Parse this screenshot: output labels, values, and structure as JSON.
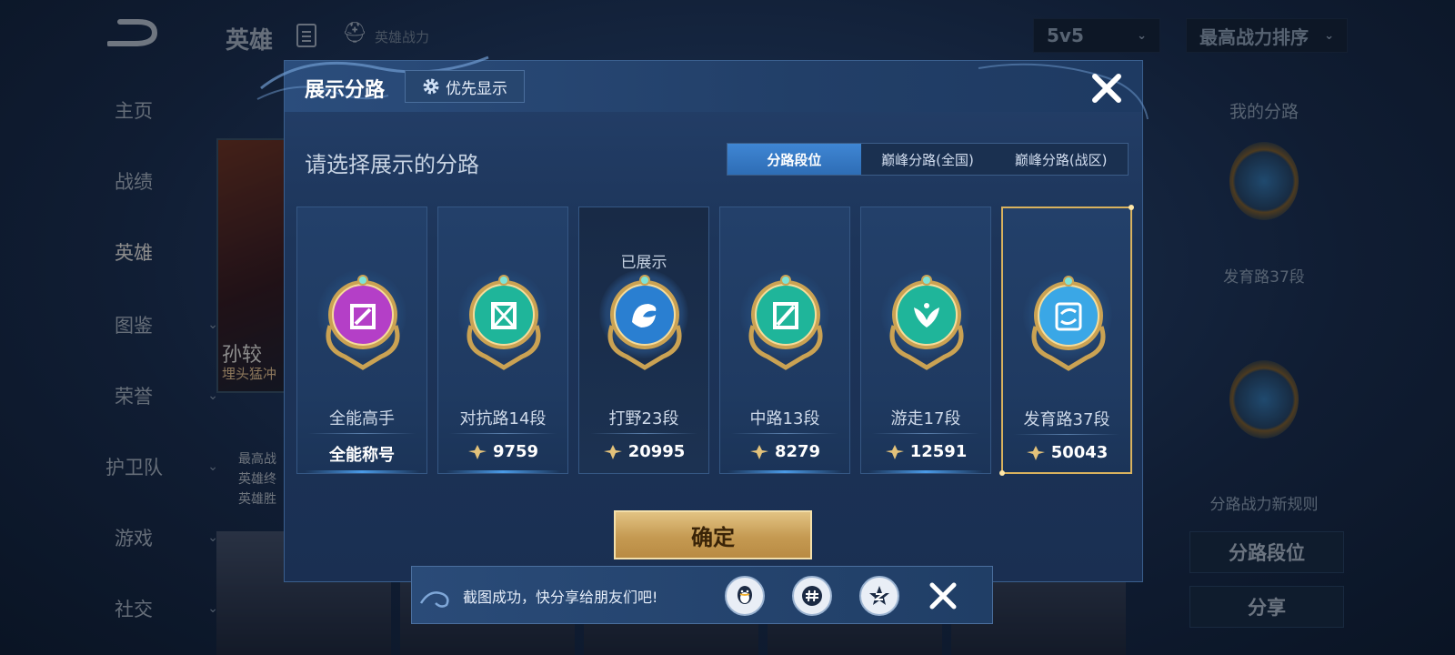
{
  "background": {
    "title": "英雄",
    "subtitle": "英雄战力",
    "mode_select": "5v5",
    "sort_select": "最高战力排序",
    "nav": [
      {
        "label": "主页",
        "chevron": false,
        "active": false
      },
      {
        "label": "战绩",
        "chevron": false,
        "active": false
      },
      {
        "label": "英雄",
        "chevron": false,
        "active": true
      },
      {
        "label": "图鉴",
        "chevron": true,
        "active": false
      },
      {
        "label": "荣誉",
        "chevron": true,
        "active": false
      },
      {
        "label": "护卫队",
        "chevron": true,
        "active": false
      },
      {
        "label": "游戏",
        "chevron": true,
        "active": false
      },
      {
        "label": "社交",
        "chevron": true,
        "active": false
      }
    ],
    "hero_name": "孙较",
    "hero_tag": "埋头猛冲",
    "hero_info": [
      "最高战",
      "英雄终",
      "英雄胜"
    ],
    "right_panel": {
      "title": "我的分路",
      "lane": "发育路37段",
      "rules_link": "分路战力新规则",
      "lane_button": "分路段位",
      "share_button": "分享"
    }
  },
  "dialog": {
    "title": "展示分路",
    "priority_button": "优先显示",
    "subtitle": "请选择展示的分路",
    "tabs": [
      {
        "label": "分路段位",
        "active": true
      },
      {
        "label": "巅峰分路(全国)",
        "active": false
      },
      {
        "label": "巅峰分路(战区)",
        "active": false
      }
    ],
    "cards": [
      {
        "name": "全能高手",
        "value": "全能称号",
        "power_icon": false,
        "shown_label": "",
        "badge": "all-round-badge-icon",
        "color": "#b43fc7",
        "selected": false
      },
      {
        "name": "对抗路14段",
        "value": "9759",
        "power_icon": true,
        "shown_label": "",
        "badge": "clash-lane-badge-icon",
        "color": "#1fb59a",
        "selected": false
      },
      {
        "name": "打野23段",
        "value": "20995",
        "power_icon": true,
        "shown_label": "已展示",
        "badge": "jungle-badge-icon",
        "color": "#2a7fd1",
        "selected": false
      },
      {
        "name": "中路13段",
        "value": "8279",
        "power_icon": true,
        "shown_label": "",
        "badge": "mid-lane-badge-icon",
        "color": "#1fb59a",
        "selected": false
      },
      {
        "name": "游走17段",
        "value": "12591",
        "power_icon": true,
        "shown_label": "",
        "badge": "roam-badge-icon",
        "color": "#1fb59a",
        "selected": false
      },
      {
        "name": "发育路37段",
        "value": "50043",
        "power_icon": true,
        "shown_label": "",
        "badge": "farm-lane-badge-icon",
        "color": "#3aa7e6",
        "selected": true
      }
    ],
    "confirm_button": "确定"
  },
  "toast": {
    "message": "截图成功，快分享给朋友们吧!",
    "share_targets": [
      "qq-share-icon",
      "wechat-moments-share-icon",
      "qzone-share-icon"
    ]
  },
  "colors": {
    "accent_gold": "#d9b25e",
    "tab_active": "#3a7fcf",
    "dialog_bg": "#1d355a"
  }
}
